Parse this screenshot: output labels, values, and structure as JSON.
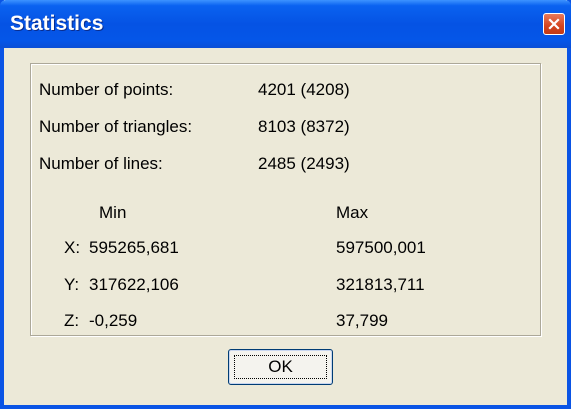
{
  "window": {
    "title": "Statistics",
    "close_icon": "close-icon"
  },
  "counts": [
    {
      "label": "Number of points:",
      "value": "4201 (4208)"
    },
    {
      "label": "Number of triangles:",
      "value": "8103 (8372)"
    },
    {
      "label": "Number of lines:",
      "value": "2485 (2493)"
    }
  ],
  "extent": {
    "min_header": "Min",
    "max_header": "Max",
    "rows": [
      {
        "axis": "X:",
        "min": "595265,681",
        "max": "597500,001"
      },
      {
        "axis": "Y:",
        "min": "317622,106",
        "max": "321813,711"
      },
      {
        "axis": "Z:",
        "min": "-0,259",
        "max": "37,799"
      }
    ]
  },
  "buttons": {
    "ok_label": "OK"
  },
  "colors": {
    "titlebar": "#0553e4",
    "close_button": "#d4441f",
    "dialog_background": "#ece9d8"
  }
}
